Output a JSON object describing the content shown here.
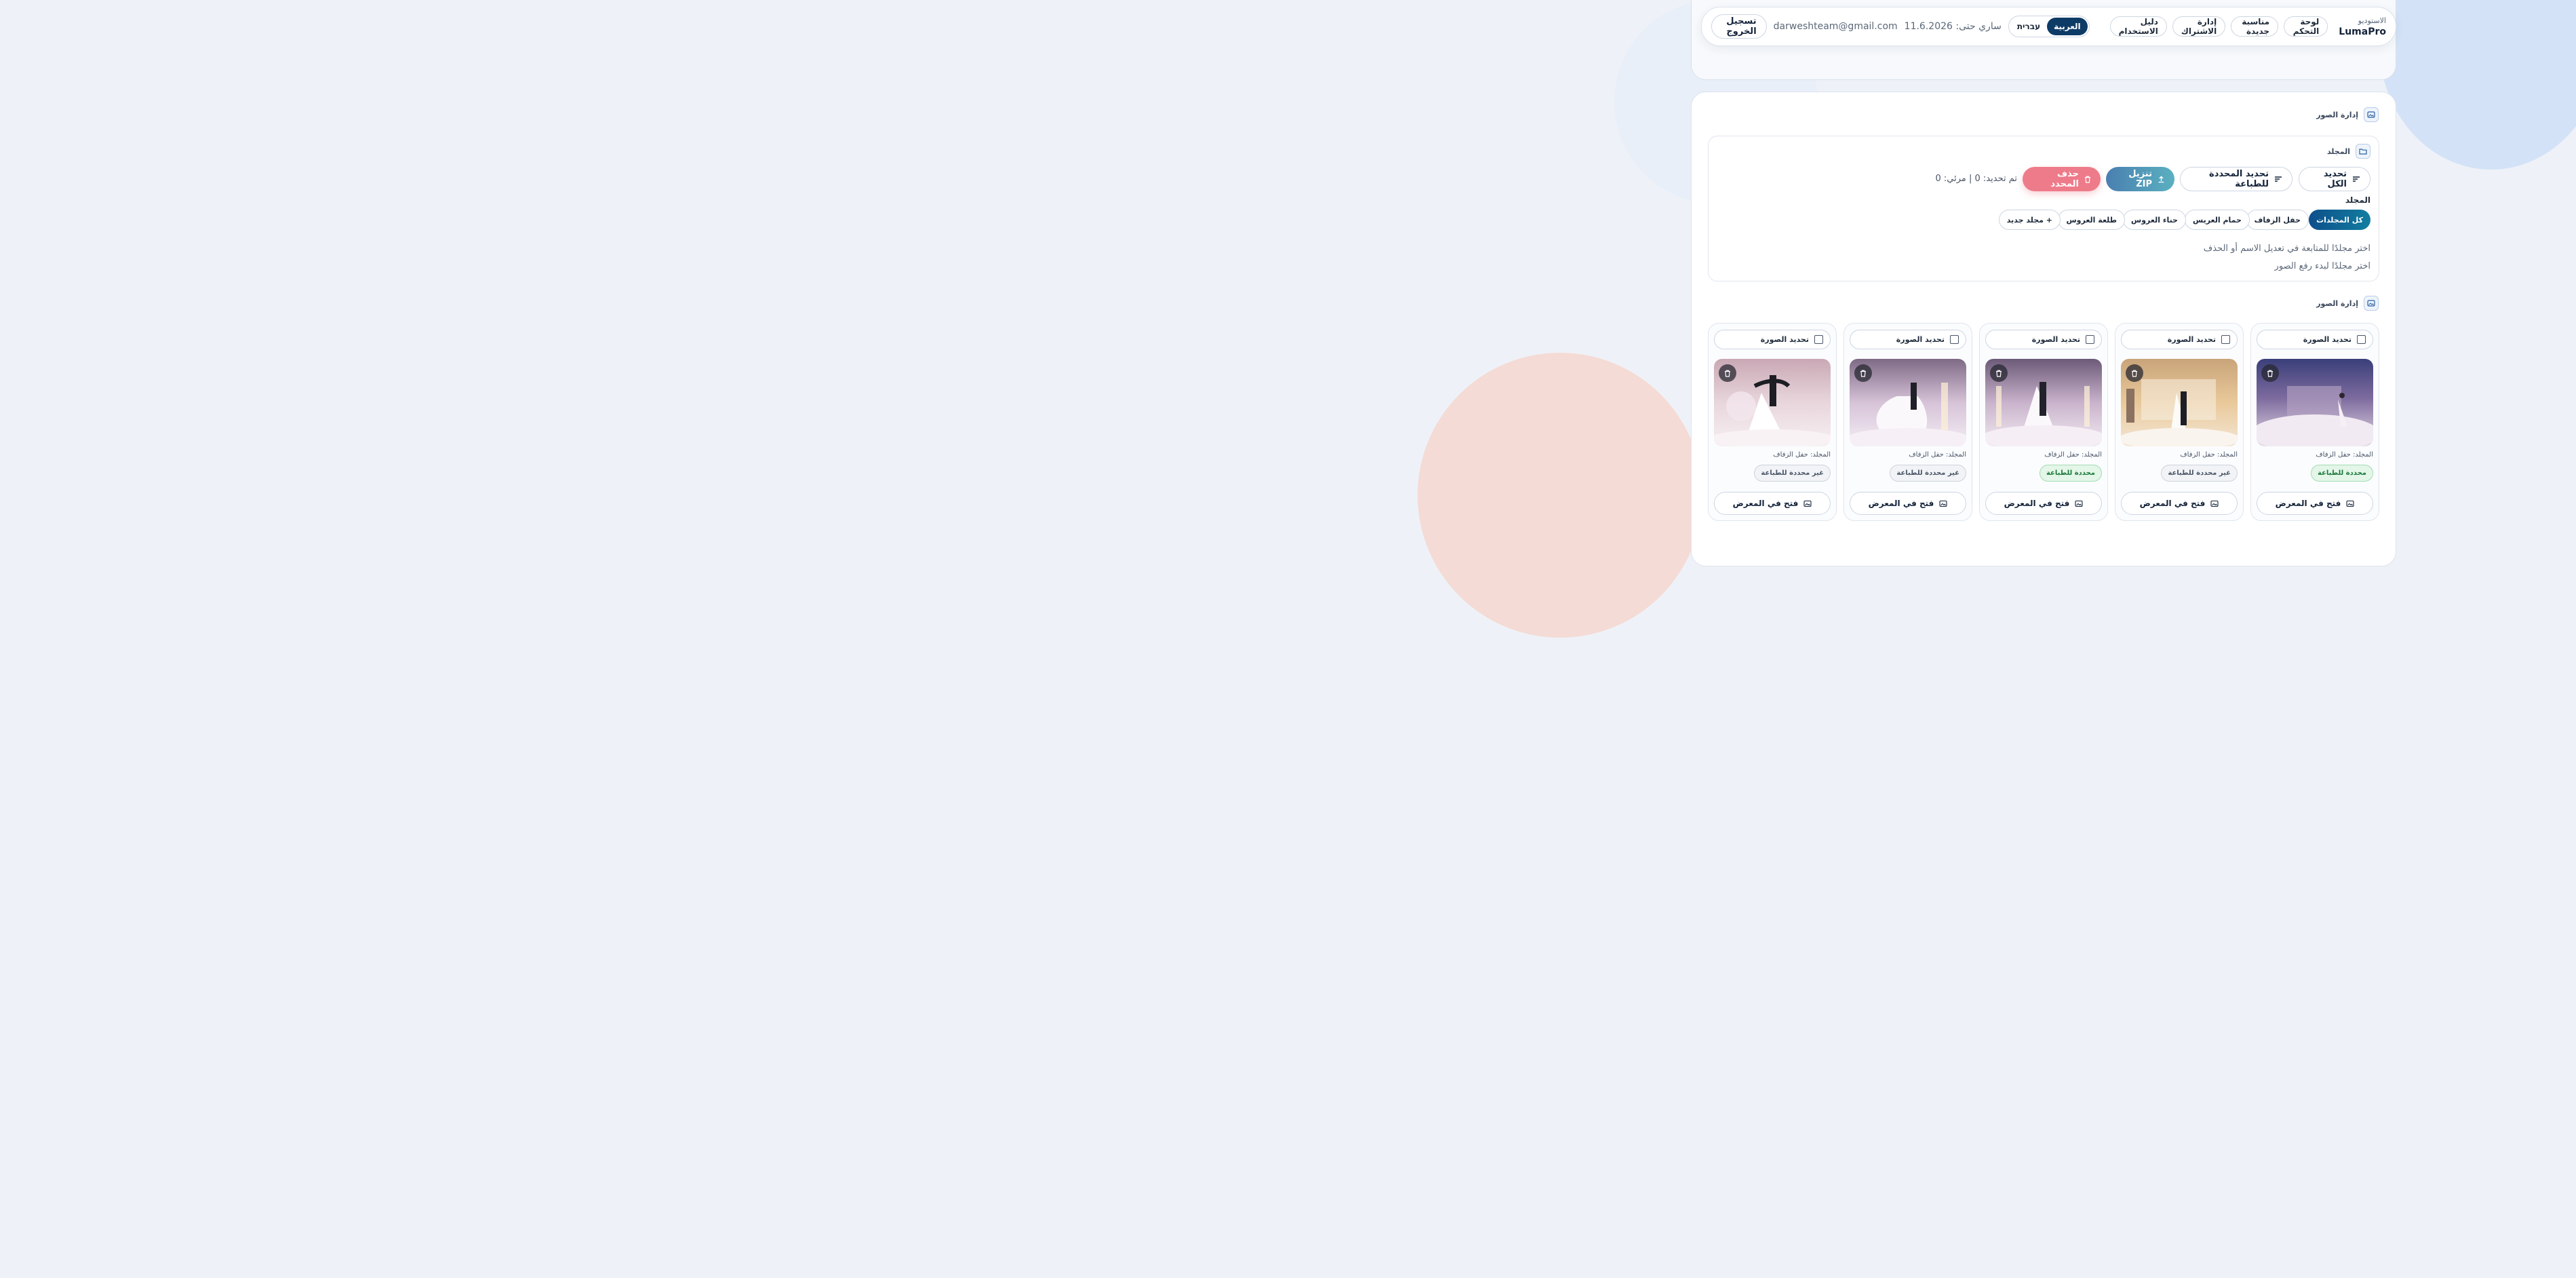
{
  "nav": {
    "brand_small": "الاستوديو",
    "brand_name": "LumaPro",
    "items": [
      {
        "label": "لوحة التحكم"
      },
      {
        "label": "مناسبة جديدة"
      },
      {
        "label": "إدارة الاشتراك"
      },
      {
        "label": "دليل الاستخدام"
      }
    ],
    "lang_ar": "العربية",
    "lang_he": "עברית",
    "validity": "ساري حتى: 11.6.2026",
    "email": "darweshteam@gmail.com",
    "logout": "تسجيل الخروج"
  },
  "photos_section": {
    "title": "إدارة الصور",
    "folder_panel_title": "المجلد",
    "actions": {
      "select_all": "تحديد الكل",
      "select_print": "تحديد المحددة للطباعة",
      "zip": "تنزيل ZIP",
      "delete_selected": "حذف المحدد"
    },
    "count_text": "تم تحديد: 0 | مرئي: 0",
    "folder_label": "المجلد",
    "folders": [
      {
        "label": "كل المجلدات",
        "active": true
      },
      {
        "label": "حفل الزفاف"
      },
      {
        "label": "حمام العريس"
      },
      {
        "label": "حناء العروس"
      },
      {
        "label": "طلعة العروس"
      },
      {
        "label": "+ مجلد جديد"
      }
    ],
    "hint_edit": "اختر مجلدًا للمتابعة في تعديل الاسم أو الحذف",
    "hint_upload": "اختر مجلدًا لبدء رفع الصور"
  },
  "gallery": {
    "title": "إدارة الصور",
    "cards": [
      {
        "select_label": "تحديد الصورة",
        "folder": "المجلد: حفل الزفاف",
        "status": "محددة للطباعة",
        "print": true,
        "open": "فتح في المعرض"
      },
      {
        "select_label": "تحديد الصورة",
        "folder": "المجلد: حفل الزفاف",
        "status": "غير محددة للطباعة",
        "print": false,
        "open": "فتح في المعرض"
      },
      {
        "select_label": "تحديد الصورة",
        "folder": "المجلد: حفل الزفاف",
        "status": "محددة للطباعة",
        "print": true,
        "open": "فتح في المعرض"
      },
      {
        "select_label": "تحديد الصورة",
        "folder": "المجلد: حفل الزفاف",
        "status": "غير محددة للطباعة",
        "print": false,
        "open": "فتح في المعرض"
      },
      {
        "select_label": "تحديد الصورة",
        "folder": "المجلد: حفل الزفاف",
        "status": "غير محددة للطباعة",
        "print": false,
        "open": "فتح في المعرض"
      }
    ]
  },
  "colors": {
    "primary": "#0d3b66",
    "accent_teal": "#127ea0",
    "delete": "#ee7b8a",
    "print_on": "#1d7a3d"
  }
}
